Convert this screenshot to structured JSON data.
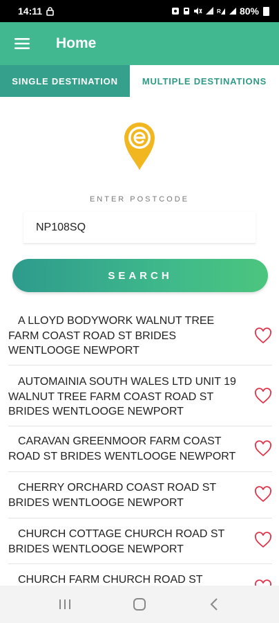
{
  "status_bar": {
    "time": "14:11",
    "battery": "80%",
    "icons": [
      "lock-icon",
      "photo-icon",
      "mute-icon",
      "wifi-icon",
      "signal-icon",
      "signal-icon",
      "battery-icon"
    ]
  },
  "toolbar": {
    "title": "Home",
    "menu_icon": "hamburger-menu-icon"
  },
  "tabs": [
    {
      "label": "SINGLE DESTINATION",
      "active": true
    },
    {
      "label": "MULTIPLE DESTINATIONS",
      "active": false
    }
  ],
  "logo": {
    "icon": "e-location-pin-icon",
    "color": "#f2b620"
  },
  "postcode": {
    "label": "ENTER POSTCODE",
    "value": "NP108SQ"
  },
  "search": {
    "label": "SEARCH"
  },
  "results": [
    {
      "address": "A LLOYD BODYWORK WALNUT TREE FARM COAST ROAD ST BRIDES WENTLOOGE NEWPORT",
      "favorite_icon": "heart-outline-icon"
    },
    {
      "address": "AUTOMAINIA SOUTH WALES LTD UNIT 19 WALNUT TREE FARM COAST ROAD ST BRIDES WENTLOOGE NEWPORT",
      "favorite_icon": "heart-outline-icon"
    },
    {
      "address": "CARAVAN GREENMOOR FARM COAST ROAD ST BRIDES WENTLOOGE NEWPORT",
      "favorite_icon": "heart-outline-icon"
    },
    {
      "address": "CHERRY ORCHARD COAST ROAD ST BRIDES WENTLOOGE NEWPORT",
      "favorite_icon": "heart-outline-icon"
    },
    {
      "address": "CHURCH COTTAGE CHURCH ROAD ST BRIDES WENTLOOGE NEWPORT",
      "favorite_icon": "heart-outline-icon"
    },
    {
      "address": "CHURCH FARM CHURCH ROAD ST",
      "favorite_icon": "heart-outline-icon"
    }
  ],
  "nav_bar": {
    "buttons": [
      "recent-apps-icon",
      "home-icon",
      "back-icon"
    ]
  },
  "colors": {
    "primary": "#41b890",
    "tab_active": "#35a08c",
    "heart": "#e0334a",
    "logo": "#f2b620"
  }
}
